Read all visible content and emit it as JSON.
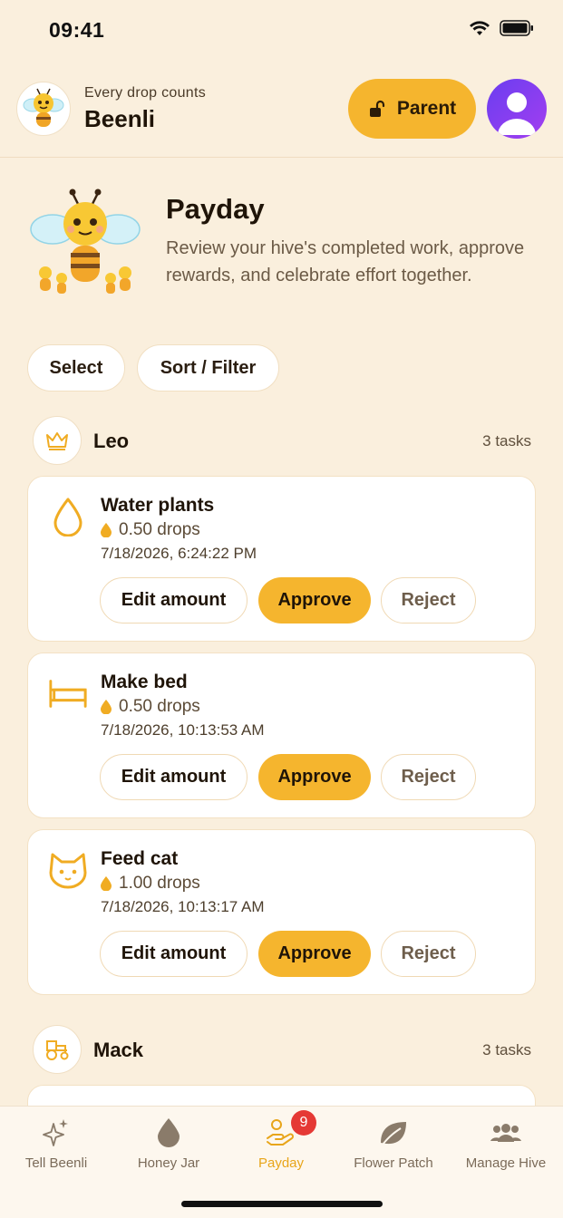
{
  "status": {
    "time": "09:41"
  },
  "header": {
    "tagline": "Every drop counts",
    "app_name": "Beenli",
    "parent_label": "Parent",
    "accent": "#f5b52e"
  },
  "hero": {
    "title": "Payday",
    "subtitle": "Review your hive's completed work, approve rewards, and celebrate effort together."
  },
  "controls": {
    "select_label": "Select",
    "sort_label": "Sort / Filter"
  },
  "sections": [
    {
      "name": "Leo",
      "count": "3 tasks",
      "icon": "crown-icon",
      "tasks": [
        {
          "title": "Water plants",
          "amount": "0.50 drops",
          "date": "7/18/2026, 6:24:22 PM",
          "icon": "water-drop-icon"
        },
        {
          "title": "Make bed",
          "amount": "0.50 drops",
          "date": "7/18/2026, 10:13:53 AM",
          "icon": "bed-icon"
        },
        {
          "title": "Feed cat",
          "amount": "1.00 drops",
          "date": "7/18/2026, 10:13:17 AM",
          "icon": "cat-icon"
        }
      ]
    },
    {
      "name": "Mack",
      "count": "3 tasks",
      "icon": "tractor-icon"
    }
  ],
  "actions": {
    "edit": "Edit amount",
    "approve": "Approve",
    "reject": "Reject"
  },
  "tabs": [
    {
      "label": "Tell Beenli",
      "icon": "sparkles-icon"
    },
    {
      "label": "Honey Jar",
      "icon": "drop-icon"
    },
    {
      "label": "Payday",
      "icon": "hand-coin-icon",
      "badge": "9",
      "active": true
    },
    {
      "label": "Flower Patch",
      "icon": "leaf-icon"
    },
    {
      "label": "Manage Hive",
      "icon": "people-icon"
    }
  ]
}
